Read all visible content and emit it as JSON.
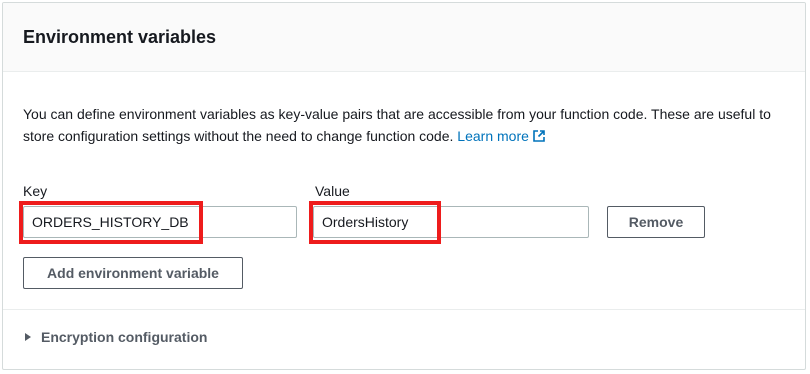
{
  "panel": {
    "title": "Environment variables",
    "description": "You can define environment variables as key-value pairs that are accessible from your function code. These are useful to store configuration settings without the need to change function code.",
    "learn_more": "Learn more"
  },
  "env_vars": {
    "key_label": "Key",
    "value_label": "Value",
    "rows": [
      {
        "key": "ORDERS_HISTORY_DB",
        "value": "OrdersHistory",
        "remove_label": "Remove"
      }
    ],
    "add_label": "Add environment variable"
  },
  "encryption": {
    "label": "Encryption configuration",
    "expanded": false
  },
  "colors": {
    "link": "#0073bb",
    "highlight": "#ee1c1c",
    "button_text": "#545b64"
  }
}
